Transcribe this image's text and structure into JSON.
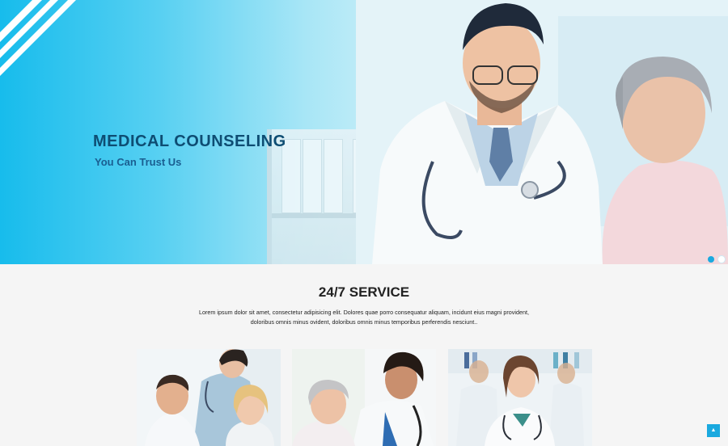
{
  "hero": {
    "title": "MEDICAL COUNSELING",
    "subtitle": "You Can Trust Us",
    "active_slide": 1,
    "slide_count": 2
  },
  "service": {
    "title": "24/7 SERVICE",
    "text_line1": "Lorem ipsum dolor sit amet, consectetur adipisicing elit. Dolores quae porro consequatur aliquam, incidunt eius magni provident,",
    "text_line2": "doloribus omnis minus ovident, doloribus omnis minus temporibus perferendis nesciunt.."
  },
  "colors": {
    "accent": "#1aa9df",
    "title": "#0e4d73",
    "subtitle": "#1a5e91"
  },
  "icons": {
    "back_to_top": "arrow-up-icon"
  }
}
